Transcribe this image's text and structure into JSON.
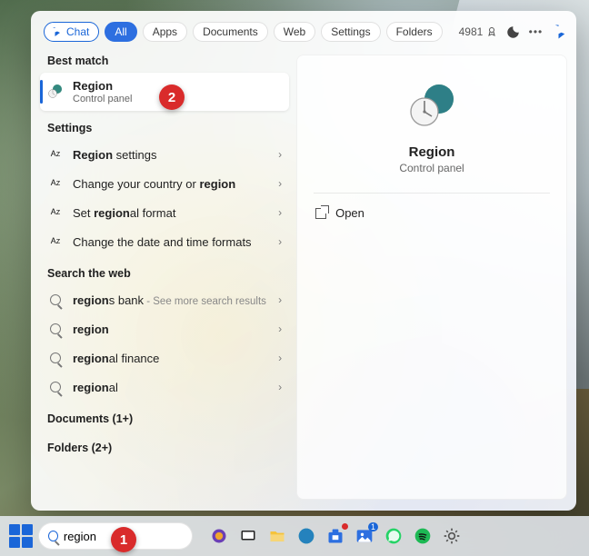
{
  "scopes": {
    "chat": "Chat",
    "all": "All",
    "apps": "Apps",
    "documents": "Documents",
    "web": "Web",
    "settings": "Settings",
    "folders": "Folders"
  },
  "top_right": {
    "points": "4981"
  },
  "sections": {
    "best_match": "Best match",
    "settings": "Settings",
    "search_web": "Search the web",
    "documents": "Documents (1+)",
    "folders": "Folders (2+)"
  },
  "best_match": {
    "title": "Region",
    "subtitle": "Control panel"
  },
  "settings_results": [
    {
      "prefix": "Region",
      "suffix": " settings"
    },
    {
      "text": "Change your country or ",
      "bold": "region"
    },
    {
      "text_a": "Set ",
      "bold": "region",
      "text_b": "al format"
    },
    {
      "text": "Change the date and time formats"
    }
  ],
  "web_results": [
    {
      "bold": "region",
      "rest": "s bank",
      "hint": " - See more search results"
    },
    {
      "bold": "region",
      "rest": ""
    },
    {
      "bold": "region",
      "rest": "al finance"
    },
    {
      "bold": "region",
      "rest": "al"
    }
  ],
  "preview": {
    "title": "Region",
    "subtitle": "Control panel",
    "open": "Open"
  },
  "search": {
    "value": "region"
  },
  "callouts": {
    "c1": "1",
    "c2": "2"
  }
}
